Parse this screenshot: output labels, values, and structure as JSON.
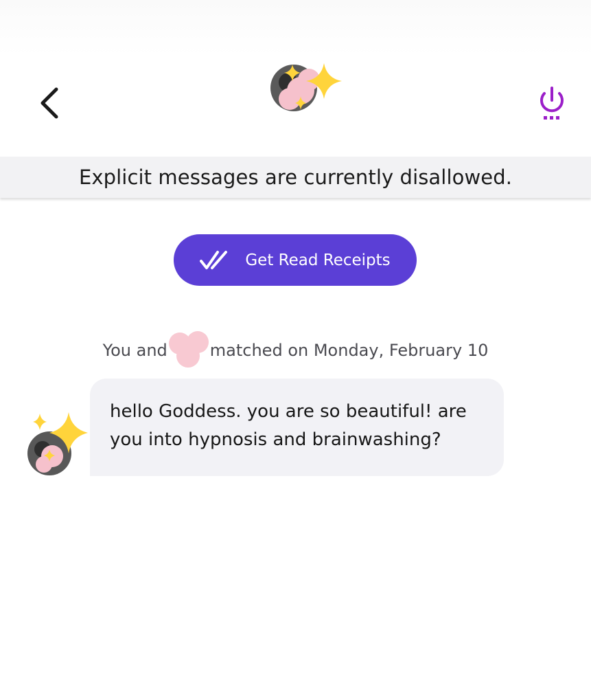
{
  "header": {
    "back_icon": "chevron-left-icon",
    "avatar_icon": "sparkle-redacted-avatar",
    "action_icon": "power-icon",
    "accent_color": "#9b1fc9"
  },
  "banner": {
    "text": "Explicit messages are currently disallowed."
  },
  "read_receipts": {
    "label": "Get Read Receipts",
    "icon": "double-check-icon",
    "color": "#5b3fd6"
  },
  "match": {
    "prefix": "You and",
    "suffix": "matched on Monday, February 10"
  },
  "message": {
    "line1": "hello Goddess. you are so beautiful! are",
    "line2": "you into hypnosis and brainwashing?"
  }
}
